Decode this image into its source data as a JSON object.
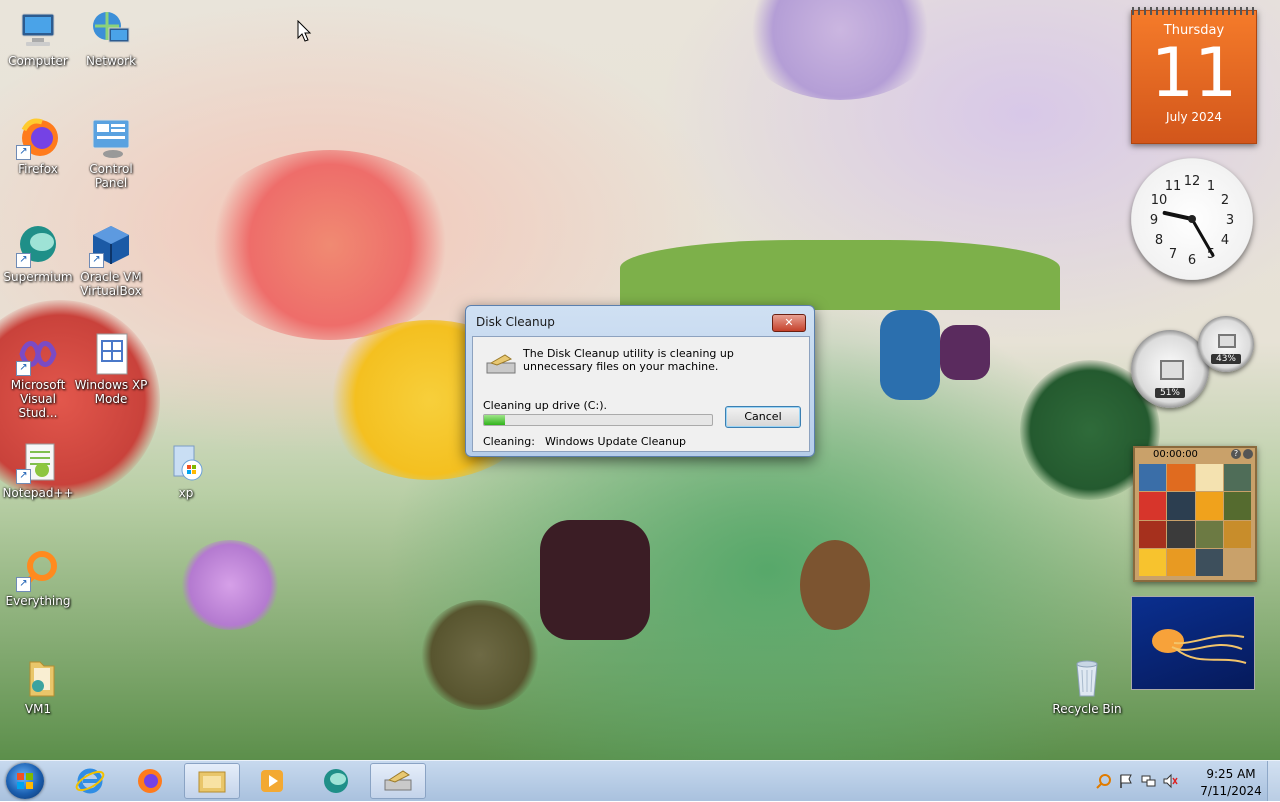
{
  "desktop": {
    "icons": [
      {
        "label": "Computer",
        "icon": "computer-icon"
      },
      {
        "label": "Network",
        "icon": "network-icon"
      },
      {
        "label": "Firefox",
        "icon": "firefox-icon"
      },
      {
        "label": "Control Panel",
        "icon": "control-panel-icon"
      },
      {
        "label": "Supermium",
        "icon": "supermium-icon"
      },
      {
        "label": "Oracle VM VirtualBox",
        "icon": "virtualbox-icon"
      },
      {
        "label": "Microsoft Visual Stud...",
        "icon": "visual-studio-icon"
      },
      {
        "label": "Windows XP Mode",
        "icon": "xp-mode-icon"
      },
      {
        "label": "Notepad++",
        "icon": "notepadpp-icon"
      },
      {
        "label": "xp",
        "icon": "xp-installer-icon"
      },
      {
        "label": "Everything",
        "icon": "everything-icon"
      },
      {
        "label": "VM1",
        "icon": "folder-icon"
      },
      {
        "label": "Recycle Bin",
        "icon": "recycle-bin-icon"
      }
    ]
  },
  "gadgets": {
    "calendar": {
      "weekday": "Thursday",
      "day": "11",
      "month_year": "July 2024"
    },
    "clock": {
      "hour": 9,
      "minute": 25
    },
    "cpu_meter": {
      "cpu": "51%",
      "memory": "43%"
    },
    "puzzle": {
      "timer": "00:00:00"
    }
  },
  "dialog": {
    "title": "Disk Cleanup",
    "close_label": "✕",
    "message": "The Disk Cleanup utility is cleaning up unnecessary files on your machine.",
    "drive_label": "Cleaning up drive  (C:).",
    "progress": 0.09,
    "cancel_label": "Cancel",
    "cleaning_label": "Cleaning:",
    "cleaning_item": "Windows Update Cleanup"
  },
  "taskbar": {
    "pinned": [
      {
        "name": "internet-explorer",
        "icon": "ie-icon"
      },
      {
        "name": "firefox",
        "icon": "firefox-icon"
      },
      {
        "name": "file-explorer",
        "icon": "explorer-icon",
        "active": true
      },
      {
        "name": "media-player",
        "icon": "media-player-icon"
      },
      {
        "name": "supermium",
        "icon": "supermium-icon"
      },
      {
        "name": "disk-cleanup",
        "icon": "disk-cleanup-icon",
        "active": true
      }
    ],
    "clock_time": "9:25 AM",
    "clock_date": "7/11/2024"
  }
}
